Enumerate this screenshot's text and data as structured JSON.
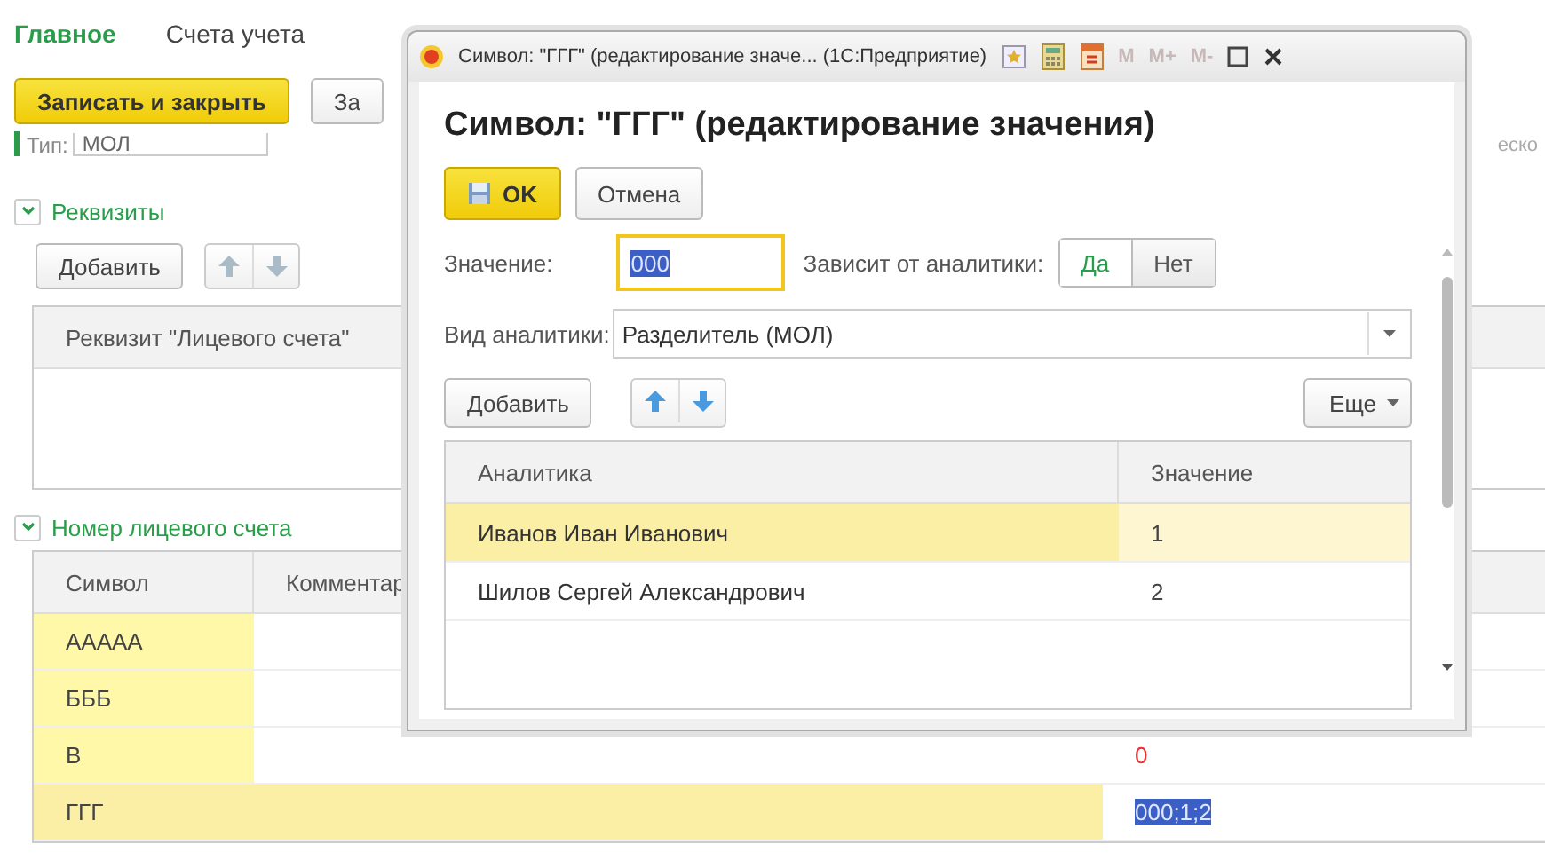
{
  "tabs": [
    {
      "label": "Главное",
      "selected": true
    },
    {
      "label": "Счета учета",
      "selected": false
    }
  ],
  "toolbar": [
    {
      "label": "Записать и закрыть",
      "kind": "primary"
    },
    {
      "label": "За",
      "kind": "normal"
    }
  ],
  "type_field": {
    "label": "Тип:",
    "value": "МОЛ"
  },
  "side_field": {
    "text": "еско"
  },
  "requisites": {
    "title": "Реквизиты",
    "expanded": true,
    "add_button": "Добавить",
    "columns": [
      "Реквизит \"Лицевого счета\""
    ]
  },
  "account_number": {
    "title": "Номер лицевого счета",
    "expanded": true,
    "columns": [
      "Символ",
      "Комментар"
    ],
    "rows": [
      {
        "symbol": "ААААА",
        "selected": false
      },
      {
        "symbol": "БББ",
        "selected": false
      },
      {
        "symbol": "В",
        "value": "0",
        "warning": true,
        "selected": false
      },
      {
        "symbol": "ГГГ",
        "value": "000;1;2",
        "text_selected": true,
        "selected": true
      }
    ]
  },
  "dialog": {
    "title": "Символ: \"ГГГ\" (редактирование значе... (1С:Предприятие)",
    "memory_buttons": [
      "M",
      "M+",
      "M-"
    ],
    "heading": "Символ: \"ГГГ\" (редактирование значения)",
    "ok": "OK",
    "cancel": "Отмена",
    "value_label": "Значение:",
    "value": "000",
    "value_text_selected": true,
    "depends_label": "Зависит от аналитики:",
    "depends_options": [
      {
        "label": "Да",
        "selected": true
      },
      {
        "label": "Нет",
        "selected": false
      }
    ],
    "kind_label": "Вид аналитики:",
    "kind_value": "Разделитель (МОЛ)",
    "add_button": "Добавить",
    "more_button": "Еще",
    "columns": [
      "Аналитика",
      "Значение"
    ],
    "rows": [
      {
        "name": "Иванов Иван Иванович",
        "value": "1",
        "selected": true
      },
      {
        "name": "Шилов Сергей Александрович",
        "value": "2",
        "selected": false
      }
    ]
  }
}
